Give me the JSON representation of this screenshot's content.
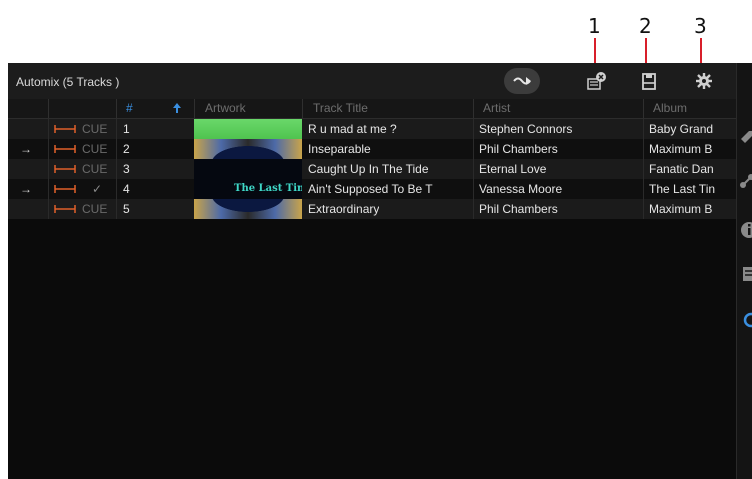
{
  "callouts": [
    "1",
    "2",
    "3"
  ],
  "panel": {
    "title": "Automix (5 Tracks )",
    "header_icons": [
      "automix-play-icon",
      "remove-track-icon",
      "save-icon",
      "settings-icon"
    ]
  },
  "columns": {
    "number": "#",
    "artwork": "Artwork",
    "track_title": "Track Title",
    "artist": "Artist",
    "album": "Album"
  },
  "tracks": [
    {
      "marker": "",
      "cue": "CUE",
      "num": "1",
      "title": "R u mad at me ?",
      "artist": "Stephen Connors",
      "album": "Baby Grand"
    },
    {
      "marker": "→",
      "cue": "CUE",
      "num": "2",
      "title": "Inseparable",
      "artist": "Phil Chambers",
      "album": "Maximum B"
    },
    {
      "marker": "",
      "cue": "CUE",
      "num": "3",
      "title": "Caught Up In The Tide",
      "artist": "Eternal Love",
      "album": "Fanatic Dan"
    },
    {
      "marker": "→",
      "cue": "✓",
      "num": "4",
      "title": "Ain't Supposed To Be T",
      "artist": "Vanessa Moore",
      "album": "The Last Tin"
    },
    {
      "marker": "",
      "cue": "CUE",
      "num": "5",
      "title": "Extraordinary",
      "artist": "Phil Chambers",
      "album": "Maximum B"
    }
  ],
  "artwork_text": "The Last Time",
  "colors": {
    "accent_orange": "#e0602a",
    "sort_arrow_blue": "#3a8fe0",
    "callout_red": "#d81f2a"
  }
}
